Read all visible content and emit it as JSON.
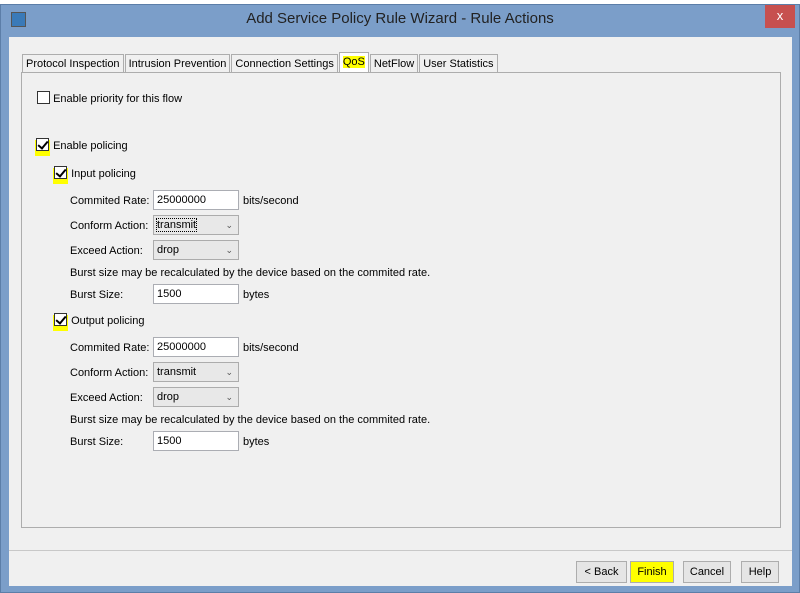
{
  "window": {
    "title": "Add Service Policy Rule Wizard - Rule Actions",
    "close": "x"
  },
  "tabs": [
    {
      "label": "Protocol Inspection"
    },
    {
      "label": "Intrusion Prevention"
    },
    {
      "label": "Connection Settings"
    },
    {
      "label": "QoS",
      "active": true
    },
    {
      "label": "NetFlow"
    },
    {
      "label": "User Statistics"
    }
  ],
  "qos": {
    "priority": {
      "label": "Enable priority for this flow",
      "checked": false
    },
    "policing": {
      "label": "Enable policing",
      "checked": true
    },
    "input": {
      "label": "Input policing",
      "checked": true,
      "rate_label": "Commited Rate:",
      "rate": "25000000",
      "rate_unit": "bits/second",
      "conform_label": "Conform Action:",
      "conform": "transmit",
      "exceed_label": "Exceed Action:",
      "exceed": "drop",
      "note": "Burst size may be recalculated by the device based on the commited rate.",
      "burst_label": "Burst Size:",
      "burst": "1500",
      "burst_unit": "bytes"
    },
    "output": {
      "label": "Output policing",
      "checked": true,
      "rate_label": "Commited Rate:",
      "rate": "25000000",
      "rate_unit": "bits/second",
      "conform_label": "Conform Action:",
      "conform": "transmit",
      "exceed_label": "Exceed Action:",
      "exceed": "drop",
      "note": "Burst size may be recalculated by the device based on the commited rate.",
      "burst_label": "Burst Size:",
      "burst": "1500",
      "burst_unit": "bytes"
    }
  },
  "buttons": {
    "back": "< Back",
    "finish": "Finish",
    "cancel": "Cancel",
    "help": "Help"
  },
  "colors": {
    "highlight": "#ffff00",
    "frame": "#7b9ec9",
    "close": "#c7504f"
  }
}
